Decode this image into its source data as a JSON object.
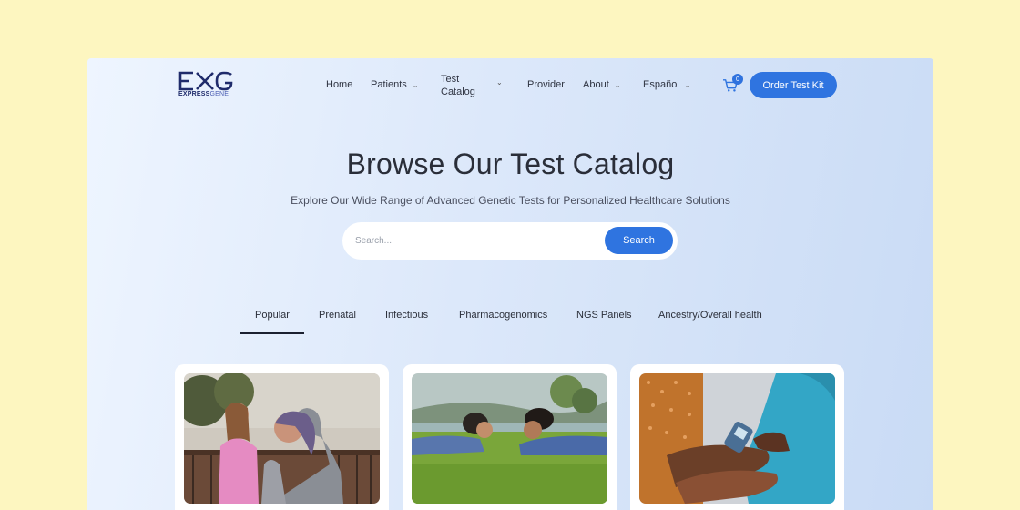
{
  "logo": {
    "mark": "EXG",
    "word_bold": "EXPRESS",
    "word_light": "GENE"
  },
  "nav": {
    "home": "Home",
    "patients": "Patients",
    "test_catalog_line1": "Test",
    "test_catalog_line2": "Catalog",
    "provider": "Provider",
    "about": "About",
    "language": "Español",
    "cart_count": "0",
    "order_button": "Order Test Kit"
  },
  "hero": {
    "title": "Browse Our Test Catalog",
    "subtitle": "Explore Our Wide Range of Advanced Genetic Tests for Personalized Healthcare Solutions"
  },
  "search": {
    "placeholder": "Search...",
    "button": "Search"
  },
  "tabs": [
    {
      "label": "Popular",
      "active": true
    },
    {
      "label": "Prenatal"
    },
    {
      "label": "Infectious"
    },
    {
      "label": "Pharmacogenomics"
    },
    {
      "label": "NGS Panels"
    },
    {
      "label": "Ancestry/Overall health"
    }
  ],
  "colors": {
    "accent": "#2f74e0",
    "page_bg": "#fdf6c0",
    "gradient_start": "#eef5ff",
    "gradient_end": "#c9dbf5"
  }
}
